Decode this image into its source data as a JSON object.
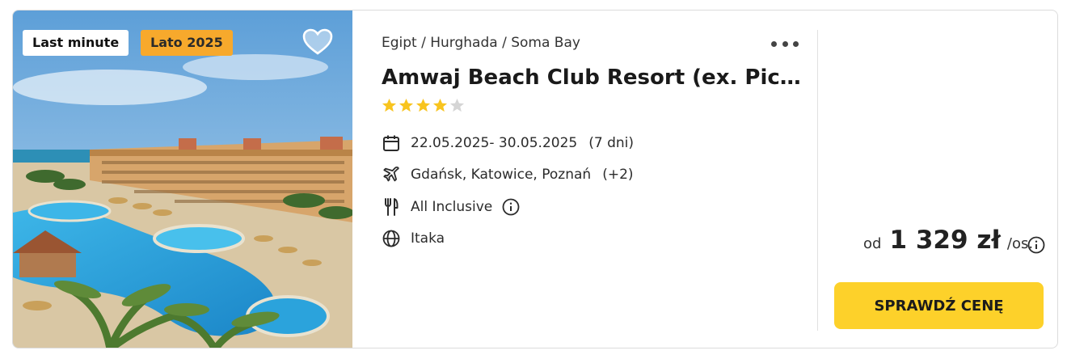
{
  "badges": {
    "last_minute": "Last minute",
    "season": "Lato 2025"
  },
  "location": {
    "breadcrumb": "Egipt / Hurghada / Soma Bay"
  },
  "hotel": {
    "name": "Amwaj Beach Club Resort (ex. Picka…",
    "rating": 4,
    "max_rating": 5
  },
  "details": {
    "dates": "22.05.2025- 30.05.2025",
    "duration": "(7 dni)",
    "departures": "Gdańsk, Katowice, Poznań",
    "departures_more": "(+2)",
    "board": "All Inclusive",
    "operator": "Itaka"
  },
  "price": {
    "prefix": "od",
    "amount": "1 329 zł",
    "suffix": "/os."
  },
  "cta": {
    "label": "SPRAWDŹ CENĘ"
  },
  "colors": {
    "cta": "#fdd12a",
    "star": "#f8c41f",
    "star_empty": "#d5d5d5",
    "season_badge": "#f7a92c"
  },
  "icons": [
    "heart-icon",
    "more-dots-icon",
    "calendar-icon",
    "plane-icon",
    "cutlery-icon",
    "info-icon",
    "globe-icon"
  ]
}
